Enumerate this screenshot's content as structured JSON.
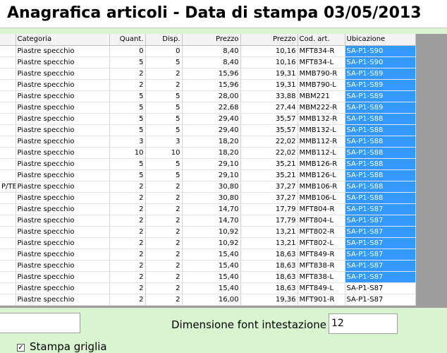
{
  "title": "Anagrafica articoli - Data di stampa 03/05/2013",
  "colors": {
    "selection": "#3399ff",
    "background": "#d9f5d0"
  },
  "grid": {
    "headers": [
      "",
      "Categoria",
      "Quant.",
      "Disp.",
      "Prezzo",
      "Prezzo",
      "Cod. art.",
      "Ubicazione"
    ],
    "rows": [
      {
        "c0": "",
        "cat": "Piastre specchio",
        "q": "0",
        "d": "0",
        "p1": "8,40",
        "p2": "10,16",
        "cod": "MFT834-R",
        "ub": "SA-P1-S90",
        "sel": true
      },
      {
        "c0": "",
        "cat": "Piastre specchio",
        "q": "5",
        "d": "5",
        "p1": "8,40",
        "p2": "10,16",
        "cod": "MFT834-L",
        "ub": "SA-P1-S90",
        "sel": true
      },
      {
        "c0": "",
        "cat": "Piastre specchio",
        "q": "2",
        "d": "2",
        "p1": "15,96",
        "p2": "19,31",
        "cod": "MMB790-R",
        "ub": "SA-P1-S89",
        "sel": true
      },
      {
        "c0": "",
        "cat": "Piastre specchio",
        "q": "2",
        "d": "2",
        "p1": "15,96",
        "p2": "19,31",
        "cod": "MMB790-L",
        "ub": "SA-P1-S89",
        "sel": true
      },
      {
        "c0": "",
        "cat": "Piastre specchio",
        "q": "5",
        "d": "5",
        "p1": "28,00",
        "p2": "33,88",
        "cod": "MBM221",
        "ub": "SA-P1-S89",
        "sel": true
      },
      {
        "c0": "",
        "cat": "Piastre specchio",
        "q": "5",
        "d": "5",
        "p1": "22,68",
        "p2": "27,44",
        "cod": "MBM222-R",
        "ub": "SA-P1-S89",
        "sel": true
      },
      {
        "c0": "",
        "cat": "Piastre specchio",
        "q": "5",
        "d": "5",
        "p1": "29,40",
        "p2": "35,57",
        "cod": "MMB132-R",
        "ub": "SA-P1-S88",
        "sel": true
      },
      {
        "c0": "",
        "cat": "Piastre specchio",
        "q": "5",
        "d": "5",
        "p1": "29,40",
        "p2": "35,57",
        "cod": "MMB132-L",
        "ub": "SA-P1-S88",
        "sel": true
      },
      {
        "c0": "",
        "cat": "Piastre specchio",
        "q": "3",
        "d": "3",
        "p1": "18,20",
        "p2": "22,02",
        "cod": "MMB112-R",
        "ub": "SA-P1-S88",
        "sel": true
      },
      {
        "c0": "",
        "cat": "Piastre specchio",
        "q": "10",
        "d": "10",
        "p1": "18,20",
        "p2": "22,02",
        "cod": "MMB112-L",
        "ub": "SA-P1-S88",
        "sel": true
      },
      {
        "c0": "",
        "cat": "Piastre specchio",
        "q": "5",
        "d": "5",
        "p1": "29,10",
        "p2": "35,21",
        "cod": "MMB126-R",
        "ub": "SA-P1-S88",
        "sel": true
      },
      {
        "c0": "",
        "cat": "Piastre specchio",
        "q": "5",
        "d": "5",
        "p1": "29,10",
        "p2": "35,21",
        "cod": "MMB126-L",
        "ub": "SA-P1-S88",
        "sel": true
      },
      {
        "c0": "P/TE",
        "cat": "Piastre specchio",
        "q": "2",
        "d": "2",
        "p1": "30,80",
        "p2": "37,27",
        "cod": "MMB106-R",
        "ub": "SA-P1-S88",
        "sel": true
      },
      {
        "c0": "",
        "cat": "Piastre specchio",
        "q": "2",
        "d": "2",
        "p1": "30,80",
        "p2": "37,27",
        "cod": "MMB106-L",
        "ub": "SA-P1-S88",
        "sel": true
      },
      {
        "c0": "",
        "cat": "Piastre specchio",
        "q": "2",
        "d": "2",
        "p1": "14,70",
        "p2": "17,79",
        "cod": "MFT804-R",
        "ub": "SA-P1-S87",
        "sel": true
      },
      {
        "c0": "",
        "cat": "Piastre specchio",
        "q": "2",
        "d": "2",
        "p1": "14,70",
        "p2": "17,79",
        "cod": "MFT804-L",
        "ub": "SA-P1-S87",
        "sel": true
      },
      {
        "c0": "",
        "cat": "Piastre specchio",
        "q": "2",
        "d": "2",
        "p1": "10,92",
        "p2": "13,21",
        "cod": "MFT802-R",
        "ub": "SA-P1-S87",
        "sel": true
      },
      {
        "c0": "",
        "cat": "Piastre specchio",
        "q": "2",
        "d": "2",
        "p1": "10,92",
        "p2": "13,21",
        "cod": "MFT802-L",
        "ub": "SA-P1-S87",
        "sel": true
      },
      {
        "c0": "",
        "cat": "Piastre specchio",
        "q": "2",
        "d": "2",
        "p1": "15,40",
        "p2": "18,63",
        "cod": "MFT849-R",
        "ub": "SA-P1-S87",
        "sel": true
      },
      {
        "c0": "",
        "cat": "Piastre specchio",
        "q": "2",
        "d": "2",
        "p1": "15,40",
        "p2": "18,63",
        "cod": "MFT838-R",
        "ub": "SA-P1-S87",
        "sel": true
      },
      {
        "c0": "",
        "cat": "Piastre specchio",
        "q": "2",
        "d": "2",
        "p1": "15,40",
        "p2": "18,63",
        "cod": "MFT838-L",
        "ub": "SA-P1-S87",
        "sel": true
      },
      {
        "c0": "",
        "cat": "Piastre specchio",
        "q": "2",
        "d": "2",
        "p1": "15,40",
        "p2": "18,63",
        "cod": "MFT849-L",
        "ub": "SA-P1-S87",
        "sel": false
      },
      {
        "c0": "",
        "cat": "Piastre specchio",
        "q": "2",
        "d": "2",
        "p1": "16,00",
        "p2": "19,36",
        "cod": "MFT901-R",
        "ub": "SA-P1-S87",
        "sel": false
      }
    ]
  },
  "options": {
    "left_input_value": "",
    "font_label": "Dimensione font intestazione",
    "font_value": "12",
    "grid_label": "Stampa griglia",
    "grid_checked": true
  }
}
